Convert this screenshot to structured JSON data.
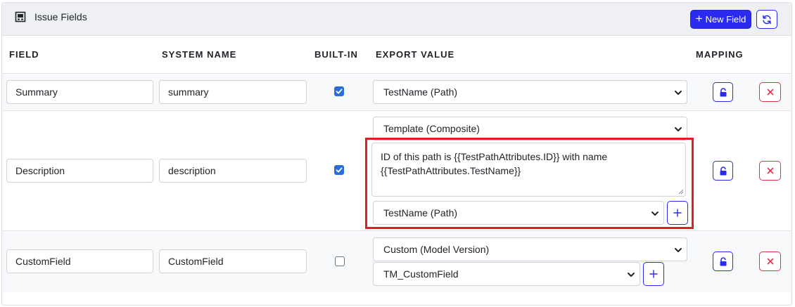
{
  "header": {
    "title": "Issue Fields",
    "new_field_label": "New Field"
  },
  "columns": {
    "field": "FIELD",
    "system_name": "SYSTEM NAME",
    "built_in": "BUILT-IN",
    "export_value": "EXPORT VALUE",
    "mapping": "MAPPING"
  },
  "rows": [
    {
      "field": "Summary",
      "system_name": "summary",
      "built_in": true,
      "export_type": "TestName (Path)"
    },
    {
      "field": "Description",
      "system_name": "description",
      "built_in": true,
      "export_type": "Template (Composite)",
      "template_line1": "ID of this path is {{TestPathAttributes.ID}} with name",
      "template_line2": "{{TestPathAttributes.TestName}}",
      "attribute": "TestName (Path)"
    },
    {
      "field": "CustomField",
      "system_name": "CustomField",
      "built_in": false,
      "export_type": "Custom (Model Version)",
      "attribute": "TM_CustomField"
    }
  ],
  "colors": {
    "primary": "#2b2bf0",
    "danger": "#dc3545",
    "highlight": "#e01e26",
    "checkbox": "#2a6edc",
    "header_bg": "#eef0f3"
  },
  "icons": {
    "header": "table-icon",
    "refresh": "refresh-icon",
    "lock": "lock-icon",
    "delete": "close-icon",
    "add": "plus-icon"
  }
}
